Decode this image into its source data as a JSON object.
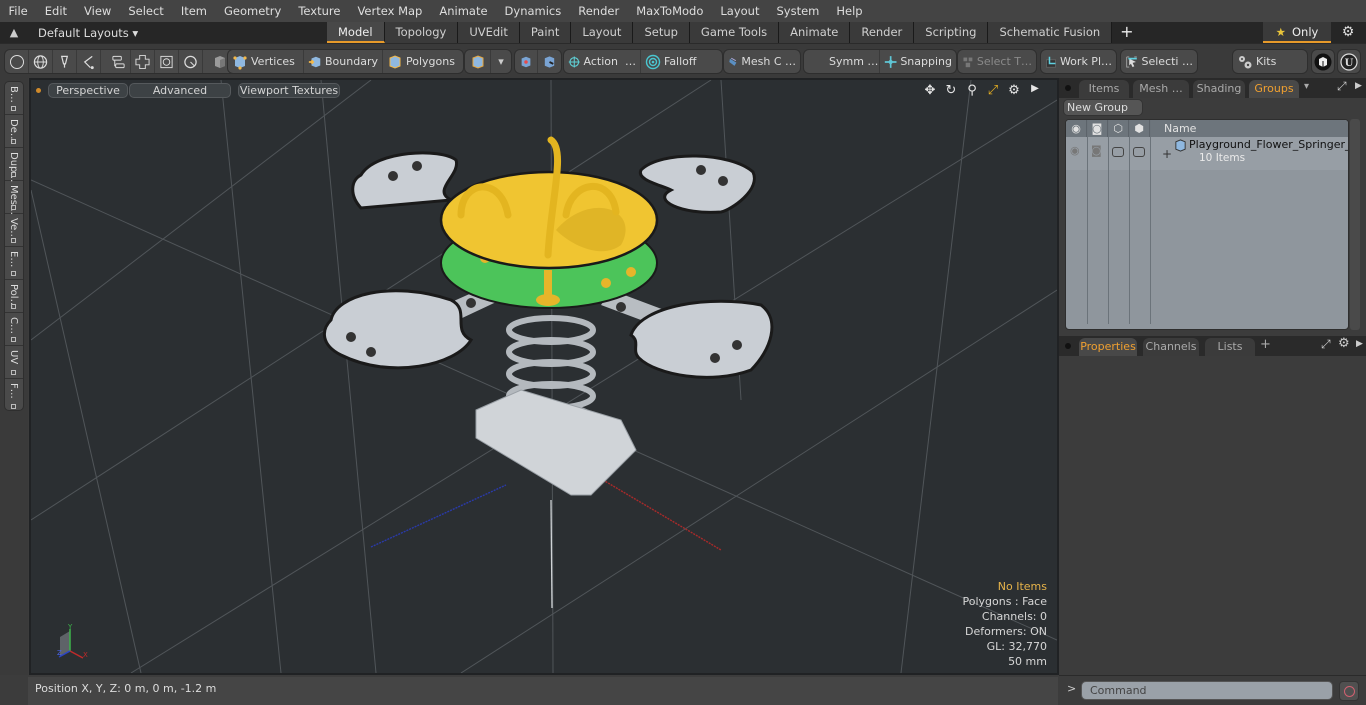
{
  "menu": [
    "File",
    "Edit",
    "View",
    "Select",
    "Item",
    "Geometry",
    "Texture",
    "Vertex Map",
    "Animate",
    "Dynamics",
    "Render",
    "MaxToModo",
    "Layout",
    "System",
    "Help"
  ],
  "layout": {
    "preset": "Default Layouts ▾",
    "tabs": [
      "Model",
      "Topology",
      "UVEdit",
      "Paint",
      "Layout",
      "Setup",
      "Game Tools",
      "Animate",
      "Render",
      "Scripting",
      "Schematic Fusion"
    ],
    "active_tab": "Model",
    "add_tab": "+",
    "only_label": "Only",
    "star": "★"
  },
  "toolbar": {
    "vertices": "Vertices",
    "boundary": "Boundary",
    "polygons": "Polygons",
    "action": "Action",
    "falloff": "Falloff",
    "mesh_c": "Mesh C …",
    "symm": "Symm …",
    "snapping": "Snapping",
    "select_t": "Select T…",
    "work_pl": "Work Pl…",
    "selecti": "Selecti …",
    "kits": "Kits",
    "ellipsis": "…"
  },
  "left_tabs": [
    "B…",
    "De…",
    "Dup…",
    "Mes…",
    "Ve…",
    "E…",
    "Pol…",
    "C…",
    "UV",
    "F…"
  ],
  "viewport": {
    "perspective": "Perspective",
    "advanced": "Advanced",
    "viewport_textures": "Viewport Textures",
    "stats": {
      "selection": "No Items",
      "polygons": "Polygons : Face",
      "channels": "Channels: 0",
      "deformers": "Deformers: ON",
      "gl": "GL: 32,770",
      "scale": "50 mm"
    },
    "colors": {
      "seat": "#f0c531",
      "disc": "#4cc45a",
      "metal": "#c9ced4",
      "bg": "#2b2f32"
    }
  },
  "status": {
    "position": "Position X, Y, Z:   0 m, 0 m, -1.2 m"
  },
  "panel_top": {
    "tabs": [
      "Items",
      "Mesh …",
      "Shading",
      "Groups"
    ],
    "active": "Groups",
    "new_group": "New Group",
    "columns": {
      "name": "Name"
    },
    "rows": [
      {
        "name": "Playground_Flower_Springer_…",
        "sub": "10 Items",
        "expand": "+"
      }
    ]
  },
  "panel_bottom": {
    "tabs": [
      "Properties",
      "Channels",
      "Lists"
    ],
    "active": "Properties",
    "add": "+"
  },
  "command": {
    "prompt": ">",
    "placeholder": "Command"
  }
}
